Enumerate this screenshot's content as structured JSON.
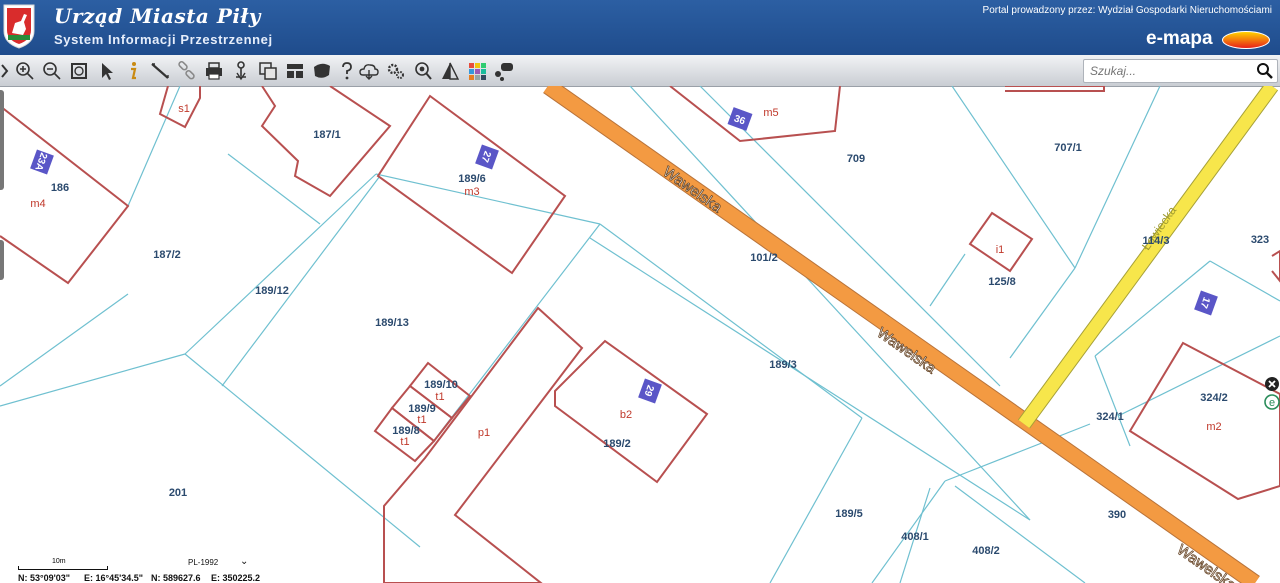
{
  "header": {
    "title": "Urząd Miasta Piły",
    "subtitle": "System Informacji Przestrzennej",
    "portal": "Portal prowadzony przez: Wydział Gospodarki Nieruchomościami",
    "brand": "e-mapa"
  },
  "toolbar": {
    "icons": [
      "menu-icon",
      "zoom-in-icon",
      "zoom-out-icon",
      "zoom-extent-icon",
      "select-icon",
      "info-icon",
      "measure-icon",
      "link-icon",
      "print-icon",
      "pin-icon",
      "copy-icon",
      "layout-icon",
      "shape-icon",
      "help-icon",
      "cloud-icon",
      "settings-icon",
      "search-zoom-icon",
      "triangle-icon",
      "layers-icon",
      "chat-icon"
    ]
  },
  "search": {
    "placeholder": "Szukaj..."
  },
  "status": {
    "scale": "10m",
    "crs": "PL-1992",
    "lat": "N: 53°09'03\"",
    "lon": "E: 16°45'34.5\"",
    "northing": "N: 589627.6",
    "easting": "E: 350225.2"
  },
  "map": {
    "streets": [
      {
        "name": "Wawelska"
      },
      {
        "name": "Wawelska"
      },
      {
        "name": "Wawelska"
      },
      {
        "name": "Łowiecka"
      }
    ],
    "parcels": [
      "s1",
      "187/1",
      "186",
      "m4",
      "187/2",
      "189/6",
      "m3",
      "189/12",
      "189/13",
      "189/10",
      "t1",
      "189/9",
      "t1",
      "189/8",
      "t1",
      "p1",
      "b2",
      "189/2",
      "201",
      "m5",
      "709",
      "101/2",
      "189/3",
      "189/5",
      "408/1",
      "408/2",
      "390",
      "707/1",
      "i1",
      "125/8",
      "114/3",
      "323",
      "324/1",
      "324/2",
      "m2"
    ],
    "house_numbers": [
      "23A",
      "27",
      "36",
      "29",
      "17"
    ]
  },
  "colors": {
    "road_main": "#f39a42",
    "road_secondary": "#f7e64b",
    "parcel_line": "#6fc0d0",
    "building": "#b85050",
    "parcel_label": "#2b4a6e",
    "building_label": "#c0392b",
    "house_badge": "#5a56c7"
  }
}
